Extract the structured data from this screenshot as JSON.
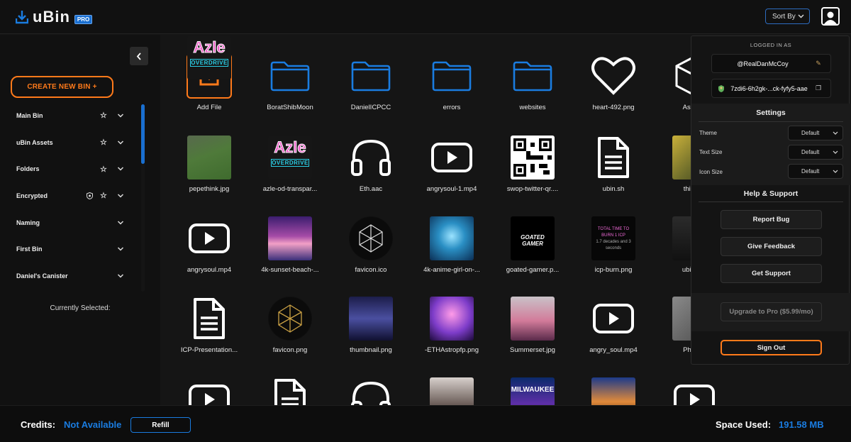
{
  "app": {
    "name": "uBin",
    "badge": "PRO"
  },
  "header": {
    "sort_label": "Sort By"
  },
  "sidebar": {
    "create_label": "CREATE NEW BIN +",
    "bins": [
      {
        "label": "Main Bin",
        "starred": true,
        "encrypted": false
      },
      {
        "label": "uBin Assets",
        "starred": true,
        "encrypted": false
      },
      {
        "label": "Folders",
        "starred": true,
        "encrypted": false
      },
      {
        "label": "Encrypted",
        "starred": true,
        "encrypted": true
      },
      {
        "label": "Naming",
        "starred": false,
        "encrypted": false
      },
      {
        "label": "First Bin",
        "starred": false,
        "encrypted": false
      },
      {
        "label": "Daniel's Canister",
        "starred": false,
        "encrypted": false
      }
    ],
    "currently_selected": "Currently Selected:"
  },
  "files": [
    {
      "name": "Add File",
      "kind": "add"
    },
    {
      "name": "BoratShibMoon",
      "kind": "folder"
    },
    {
      "name": "DanielICPCC",
      "kind": "folder"
    },
    {
      "name": "errors",
      "kind": "folder"
    },
    {
      "name": "websites",
      "kind": "folder"
    },
    {
      "name": "heart-492.png",
      "kind": "heart"
    },
    {
      "name": "Astrona",
      "kind": "cube"
    },
    {
      "name": "pepethink.jpg",
      "kind": "thumb-pepe"
    },
    {
      "name": "azle-od-transpar...",
      "kind": "thumb-azle"
    },
    {
      "name": "Eth.aac",
      "kind": "audio"
    },
    {
      "name": "angrysoul-1.mp4",
      "kind": "video"
    },
    {
      "name": "swop-twitter-qr....",
      "kind": "qr"
    },
    {
      "name": "ubin.sh",
      "kind": "doc"
    },
    {
      "name": "this-is-f",
      "kind": "thumb-yellow"
    },
    {
      "name": "angrysoul.mp4",
      "kind": "video"
    },
    {
      "name": "4k-sunset-beach-...",
      "kind": "thumb-sunset"
    },
    {
      "name": "favicon.ico",
      "kind": "thumb-icp"
    },
    {
      "name": "4k-anime-girl-on-...",
      "kind": "thumb-anime"
    },
    {
      "name": "goated-gamer.p...",
      "kind": "thumb-goated"
    },
    {
      "name": "icp-burn.png",
      "kind": "thumb-burn"
    },
    {
      "name": "ubin-ma",
      "kind": "thumb-dark"
    },
    {
      "name": "ICP-Presentation...",
      "kind": "doc"
    },
    {
      "name": "favicon.png",
      "kind": "thumb-icp-gold"
    },
    {
      "name": "thumbnail.png",
      "kind": "thumb-city"
    },
    {
      "name": "-ETHAstropfp.png",
      "kind": "thumb-astro"
    },
    {
      "name": "Summerset.jpg",
      "kind": "thumb-crowd"
    },
    {
      "name": "angry_soul.mp4",
      "kind": "video"
    },
    {
      "name": "Philade",
      "kind": "thumb-gray"
    },
    {
      "name": "",
      "kind": "video"
    },
    {
      "name": "",
      "kind": "doc"
    },
    {
      "name": "",
      "kind": "audio"
    },
    {
      "name": "",
      "kind": "thumb-portrait"
    },
    {
      "name": "",
      "kind": "thumb-milwaukee"
    },
    {
      "name": "",
      "kind": "thumb-sky"
    },
    {
      "name": "",
      "kind": "video"
    },
    {
      "name": "",
      "kind": "thumb-azle"
    }
  ],
  "footer": {
    "credits_label": "Credits:",
    "credits_value": "Not Available",
    "refill_label": "Refill",
    "space_label": "Space Used:",
    "space_value": "191.58 MB"
  },
  "panel": {
    "logged_in_label": "LOGGED IN AS",
    "username": "@RealDanMcCoy",
    "principal": "7zdi6-6h2gk-...ck-fyfy5-aae",
    "settings_title": "Settings",
    "settings": [
      {
        "label": "Theme",
        "value": "Default"
      },
      {
        "label": "Text Size",
        "value": "Default"
      },
      {
        "label": "Icon Size",
        "value": "Default"
      }
    ],
    "help_title": "Help & Support",
    "help_buttons": [
      "Report Bug",
      "Give Feedback",
      "Get Support"
    ],
    "upgrade_label": "Upgrade to Pro ($5.99/mo)",
    "signout_label": "Sign Out"
  },
  "colors": {
    "accent": "#1a7ce0",
    "orange": "#ff7a1a"
  }
}
